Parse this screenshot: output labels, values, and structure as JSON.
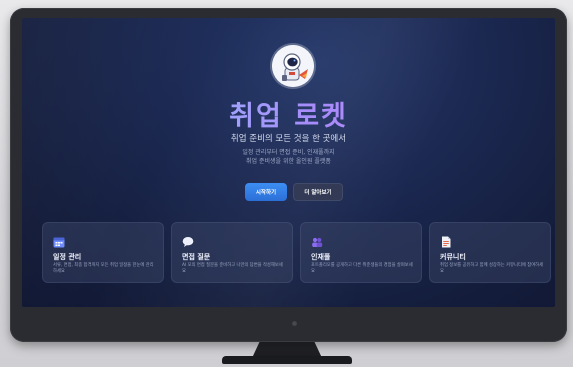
{
  "hero": {
    "title": "취업 로켓",
    "subtitle": "취업 준비의 모든 것을 한 곳에서",
    "description_lines": [
      "일정 관리부터 면접 준비, 인재풀까지",
      "취업 준비생을 위한 올인원 플랫폼"
    ]
  },
  "buttons": {
    "start_label": "시작하기",
    "learn_more_label": "더 알아보기"
  },
  "features": [
    {
      "icon": "calendar-icon",
      "title": "일정 관리",
      "desc": "서류, 면접, 최종 합격까지 모든 취업 일정을 한눈에 관리하세요"
    },
    {
      "icon": "speech-bubble-icon",
      "title": "면접 질문",
      "desc": "AI 모의 면접 질문을 준비하고 나만의 답변을 작성해보세요"
    },
    {
      "icon": "people-icon",
      "title": "인재풀",
      "desc": "포트폴리오를 공개하고 다른 취준생들의 경험을 살펴보세요"
    },
    {
      "icon": "document-icon",
      "title": "커뮤니티",
      "desc": "취업 정보를 공유하고 함께 성장하는 커뮤니티에 참여하세요"
    }
  ],
  "colors": {
    "primary": "#3d8ef4",
    "title_gradient_start": "#8fd8ff",
    "title_gradient_end": "#d08cff",
    "screen_bg": "#141d3c"
  }
}
